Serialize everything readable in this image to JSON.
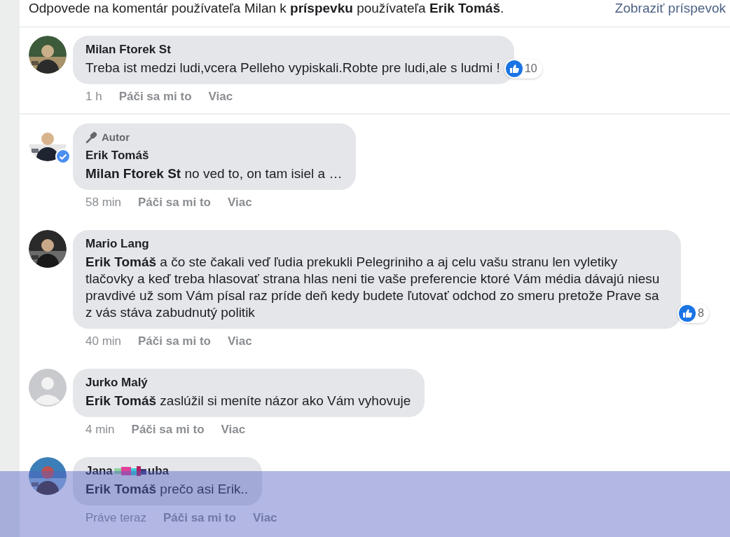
{
  "header": {
    "text": "Odpovede na komentár používateľa Milan k **príspevku** používateľa **Erik Tomáš**.",
    "link": "Zobraziť príspevok"
  },
  "comments": [
    {
      "verified": false,
      "author": "Milan Ftorek St",
      "text": "Treba ist medzi ludi,vcera Pelleho vypiskali.Robte pre ludi,ale s ludmi !",
      "time": "1 h",
      "like": "Páči sa mi to",
      "more": "Viac",
      "reactions": "10",
      "overlay": false
    },
    {
      "verified": true,
      "badge": "Autor",
      "author": "Erik Tomáš",
      "mention": "Milan Ftorek St",
      "text": "no ved to, on tam isiel a …",
      "time": "58 min",
      "like": "Páči sa mi to",
      "more": "Viac",
      "overlay": false
    },
    {
      "verified": false,
      "author": "Mario Lang",
      "mention": "Erik Tomáš",
      "text": "a čo ste čakali veď ľudia prekukli Pelegriniho a aj celu vašu stranu len vyletiky tlačovky a keď treba hlasovať strana hlas neni tie vaše preferencie ktoré Vám média dávajú niesu pravdivé už som Vám písal raz príde deň kedy budete ľutovať odchod zo smeru pretože Prave sa z vás stáva zabudnutý politik",
      "time": "40 min",
      "like": "Páči sa mi to",
      "more": "Viac",
      "reactions": "8",
      "overlay": false
    },
    {
      "kind": "default",
      "verified": false,
      "author": "Jurko Malý",
      "mention": "Erik Tomáš",
      "text": "zaslúžil si meníte názor ako Vám vyhovuje",
      "time": "4 min",
      "like": "Páči sa mi to",
      "more": "Viac",
      "overlay": false
    },
    {
      "verified": false,
      "author": "Jana",
      "author_tail": "uba",
      "mention": "Erik Tomáš",
      "text": "prečo asi Erik..",
      "time": "Práve teraz",
      "like": "Páči sa mi to",
      "more": "Viac",
      "overlay": true
    }
  ]
}
